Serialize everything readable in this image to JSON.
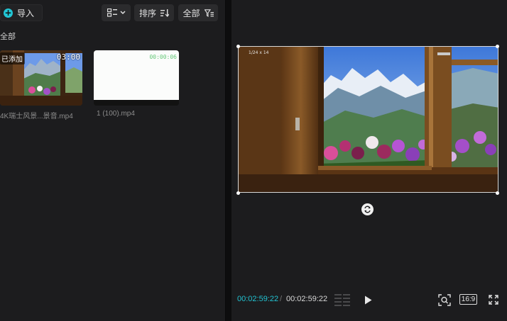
{
  "toolbar": {
    "import_label": "导入",
    "sort_label": "排序",
    "filter_label": "全部"
  },
  "media": {
    "section_label": "全部",
    "items": [
      {
        "name": "4K瑞士风景...景音.mp4",
        "badge": "已添加",
        "duration": "03:00"
      },
      {
        "name": "1 (100).mp4",
        "duration": "00:00:06"
      }
    ]
  },
  "player": {
    "overlay_text": "1/24 x 14",
    "current_time": "00:02:59:22",
    "separator": "/",
    "total_time": "00:02:59:22",
    "ratio": "16:9"
  },
  "colors": {
    "accent": "#22c7d6",
    "panel": "#1c1c1e",
    "button": "#2b2b2d"
  }
}
